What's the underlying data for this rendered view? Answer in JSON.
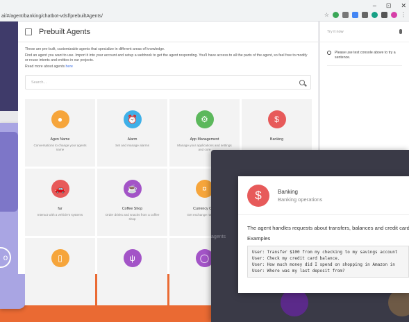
{
  "browser": {
    "url": "ai/#/agent/banking/chatbot-vdsf/prebuiltAgents/",
    "window_controls": [
      "–",
      "⊡",
      "✕"
    ]
  },
  "header": {
    "title": "Prebuilt Agents"
  },
  "intro": {
    "line1": "These are pre-built, customizable agents that specialize in different areas of knowledge.",
    "line2": "Find an agent you want to use. Import it into your account and setup a webhook to get the agent responding. You'll have access to all the parts of the agent, so feel free to modify or reuse intents and entities in our projects.",
    "line3_prefix": "Read more about agents ",
    "line3_link": "here"
  },
  "search": {
    "placeholder": "Search..."
  },
  "agents": [
    {
      "name": "Agen Name",
      "desc": "Conversations to change your agents name",
      "color": "#f6a53b",
      "icon": "person-icon",
      "glyph": "●"
    },
    {
      "name": "Alarm",
      "desc": "Set and manage alarms",
      "color": "#3fb0e8",
      "icon": "alarm-icon",
      "glyph": "⏰"
    },
    {
      "name": "App Management",
      "desc": "Manage your applications and settings and core",
      "color": "#5cb85c",
      "icon": "gears-icon",
      "glyph": "⚙"
    },
    {
      "name": "Banking",
      "desc": "",
      "color": "#e75a5a",
      "icon": "dollar-icon",
      "glyph": "$"
    },
    {
      "name": "far",
      "desc": "Interact with a vehicle's systems",
      "color": "#e75a5a",
      "icon": "car-icon",
      "glyph": "🚗"
    },
    {
      "name": "Coffee Shop",
      "desc": "Order drinks and snacks from a coffee shop",
      "color": "#a354c7",
      "icon": "coffee-icon",
      "glyph": "☕"
    },
    {
      "name": "Currency Con",
      "desc": "Get exchange rates for c",
      "color": "#f6a53b",
      "icon": "currency-icon",
      "glyph": "¤"
    },
    {
      "name": "",
      "desc": "",
      "color": "#e6e6e6",
      "icon": "blank-icon",
      "glyph": ""
    },
    {
      "name": "",
      "desc": "",
      "color": "#f6a53b",
      "icon": "phone-icon",
      "glyph": "▯"
    },
    {
      "name": "",
      "desc": "",
      "color": "#a354c7",
      "icon": "fork-knife-icon",
      "glyph": "ψ"
    },
    {
      "name": "",
      "desc": "",
      "color": "#a354c7",
      "icon": "egg-icon",
      "glyph": "◯"
    },
    {
      "name": "",
      "desc": "",
      "color": "#f3f3f3",
      "icon": "blank-icon",
      "glyph": ""
    }
  ],
  "side": {
    "try_label": "Try it now",
    "info": "Please use test console above to try a sentence."
  },
  "overlay": {
    "ghost_label": "agents"
  },
  "card": {
    "name": "Banking",
    "subtitle": "Banking operations",
    "description": "The agent handles requests about transfers, balances and credit card",
    "examples_label": "Examples",
    "examples": [
      "User: Transfer $100 from my checking to my savings account",
      "User: Check my credit card balance.",
      "User: How much money did I spend on shopping in Amazon in",
      "User: Where was my last deposit from?"
    ]
  },
  "colors": {
    "accent": "#3b6de3",
    "orange": "#ea6a33",
    "overlay": "#3a3a47"
  }
}
